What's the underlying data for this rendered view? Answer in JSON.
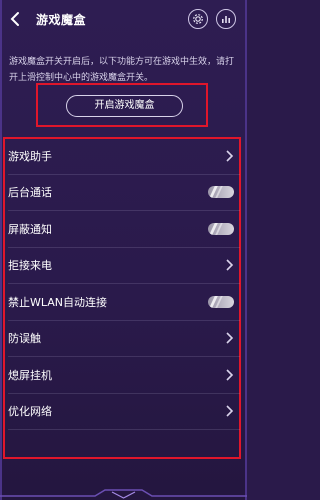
{
  "header": {
    "back_icon": "back-arrow-icon",
    "title": "游戏魔盒",
    "icons": [
      "settings-gear-icon",
      "chart-icon"
    ]
  },
  "description": "游戏魔盒开关开启后，以下功能方可在游戏中生效，请打开上滑控制中心中的游戏魔盒开关。",
  "open_button": {
    "label": "开启游戏魔盒"
  },
  "menu": {
    "items": [
      {
        "label": "游戏助手",
        "control": "chevron"
      },
      {
        "label": "后台通话",
        "control": "toggle"
      },
      {
        "label": "屏蔽通知",
        "control": "toggle"
      },
      {
        "label": "拒接来电",
        "control": "chevron"
      },
      {
        "label": "禁止WLAN自动连接",
        "control": "toggle"
      },
      {
        "label": "防误触",
        "control": "chevron"
      },
      {
        "label": "熄屏挂机",
        "control": "chevron"
      },
      {
        "label": "优化网络",
        "control": "chevron"
      }
    ]
  },
  "colors": {
    "background": "#2a1a4b",
    "highlight_box": "#e0162b",
    "toggle": "#c8c5d0"
  }
}
